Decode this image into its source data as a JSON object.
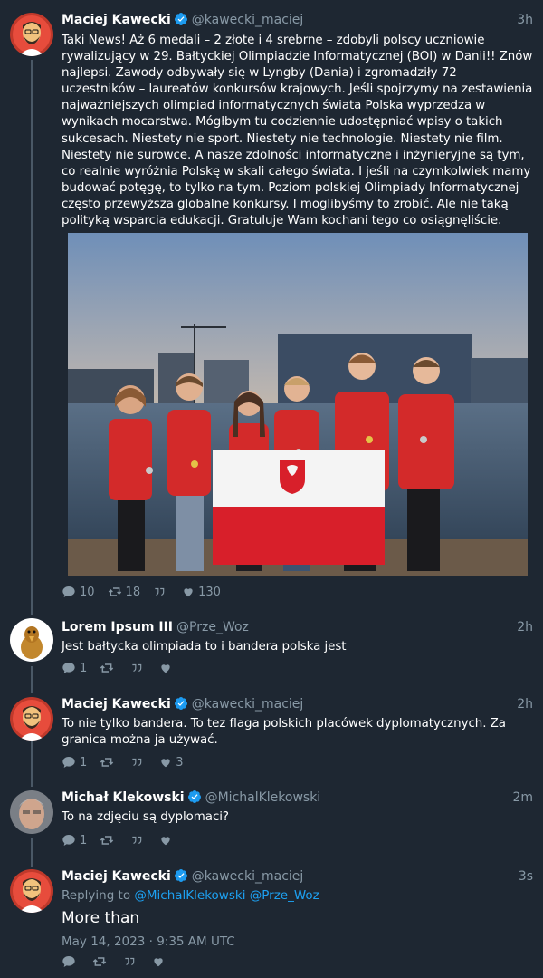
{
  "colors": {
    "background": "#1e2732",
    "accent": "#1da1f2",
    "muted": "#8899a6",
    "verified": "#1d9bf0"
  },
  "tweets": [
    {
      "name": "Maciej Kawecki",
      "handle": "@kawecki_maciej",
      "time": "3h",
      "verified": true,
      "avatar_icon": "cartoon-man-avatar",
      "text": "Taki News! Aż 6 medali – 2 złote i 4 srebrne – zdobyli polscy uczniowie rywalizujący w 29. Bałtyckiej Olimpiadzie Informatycznej (BOI) w Danii!! Znów najlepsi. Zawody odbywały się w Lyngby (Dania) i zgromadziły 72 uczestników – laureatów konkursów krajowych. Jeśli spojrzymy na zestawienia najważniejszych olimpiad informatycznych świata Polska wyprzedza w wynikach mocarstwa. Mógłbym tu codziennie udostępniać wpisy o takich sukcesach. Niestety nie sport. Niestety nie technologie. Niestety nie film. Niestety nie surowce. A nasze zdolności informatyczne i inżynieryjne są tym, co realnie wyróżnia Polskę w skali całego świata. I jeśli na czymkolwiek mamy budować potęgę, to tylko na tym. Poziom polskiej Olimpiady Informatycznej często przewyższa globalne konkursy. I moglibyśmy to zrobić. Ale nie taką polityką wsparcia edukacji. Gratuluje Wam kochani tego co osiągnęliście.",
      "image_icon": "team-photo-with-polish-flag",
      "replies": "10",
      "retweets": "18",
      "quotes": "",
      "likes": "130"
    },
    {
      "name": "Lorem Ipsum III",
      "handle": "@Prze_Woz",
      "time": "2h",
      "verified": false,
      "avatar_icon": "bird-mascot-avatar",
      "text": "Jest bałtycka olimpiada to i bandera polska jest",
      "replies": "1",
      "retweets": "",
      "quotes": "",
      "likes": ""
    },
    {
      "name": "Maciej Kawecki",
      "handle": "@kawecki_maciej",
      "time": "2h",
      "verified": true,
      "avatar_icon": "cartoon-man-avatar",
      "text": "To nie tylko bandera. To tez flaga polskich placówek dyplomatycznych. Za granica można ja używać.",
      "replies": "1",
      "retweets": "",
      "quotes": "",
      "likes": "3"
    },
    {
      "name": "Michał Klekowski",
      "handle": "@MichalKlekowski",
      "time": "2m",
      "verified": true,
      "avatar_icon": "man-photo-avatar",
      "text": "To na zdjęciu są dyplomaci?",
      "replies": "1",
      "retweets": "",
      "quotes": "",
      "likes": ""
    },
    {
      "name": "Maciej Kawecki",
      "handle": "@kawecki_maciej",
      "time": "3s",
      "verified": true,
      "avatar_icon": "cartoon-man-avatar",
      "replying_prefix": "Replying to",
      "replying_mention1": "@MichalKlekowski",
      "replying_mention2": "@Prze_Woz",
      "text": "More than",
      "date": "May 14, 2023 · 9:35 AM UTC",
      "replies": "",
      "retweets": "",
      "quotes": "",
      "likes": ""
    }
  ]
}
